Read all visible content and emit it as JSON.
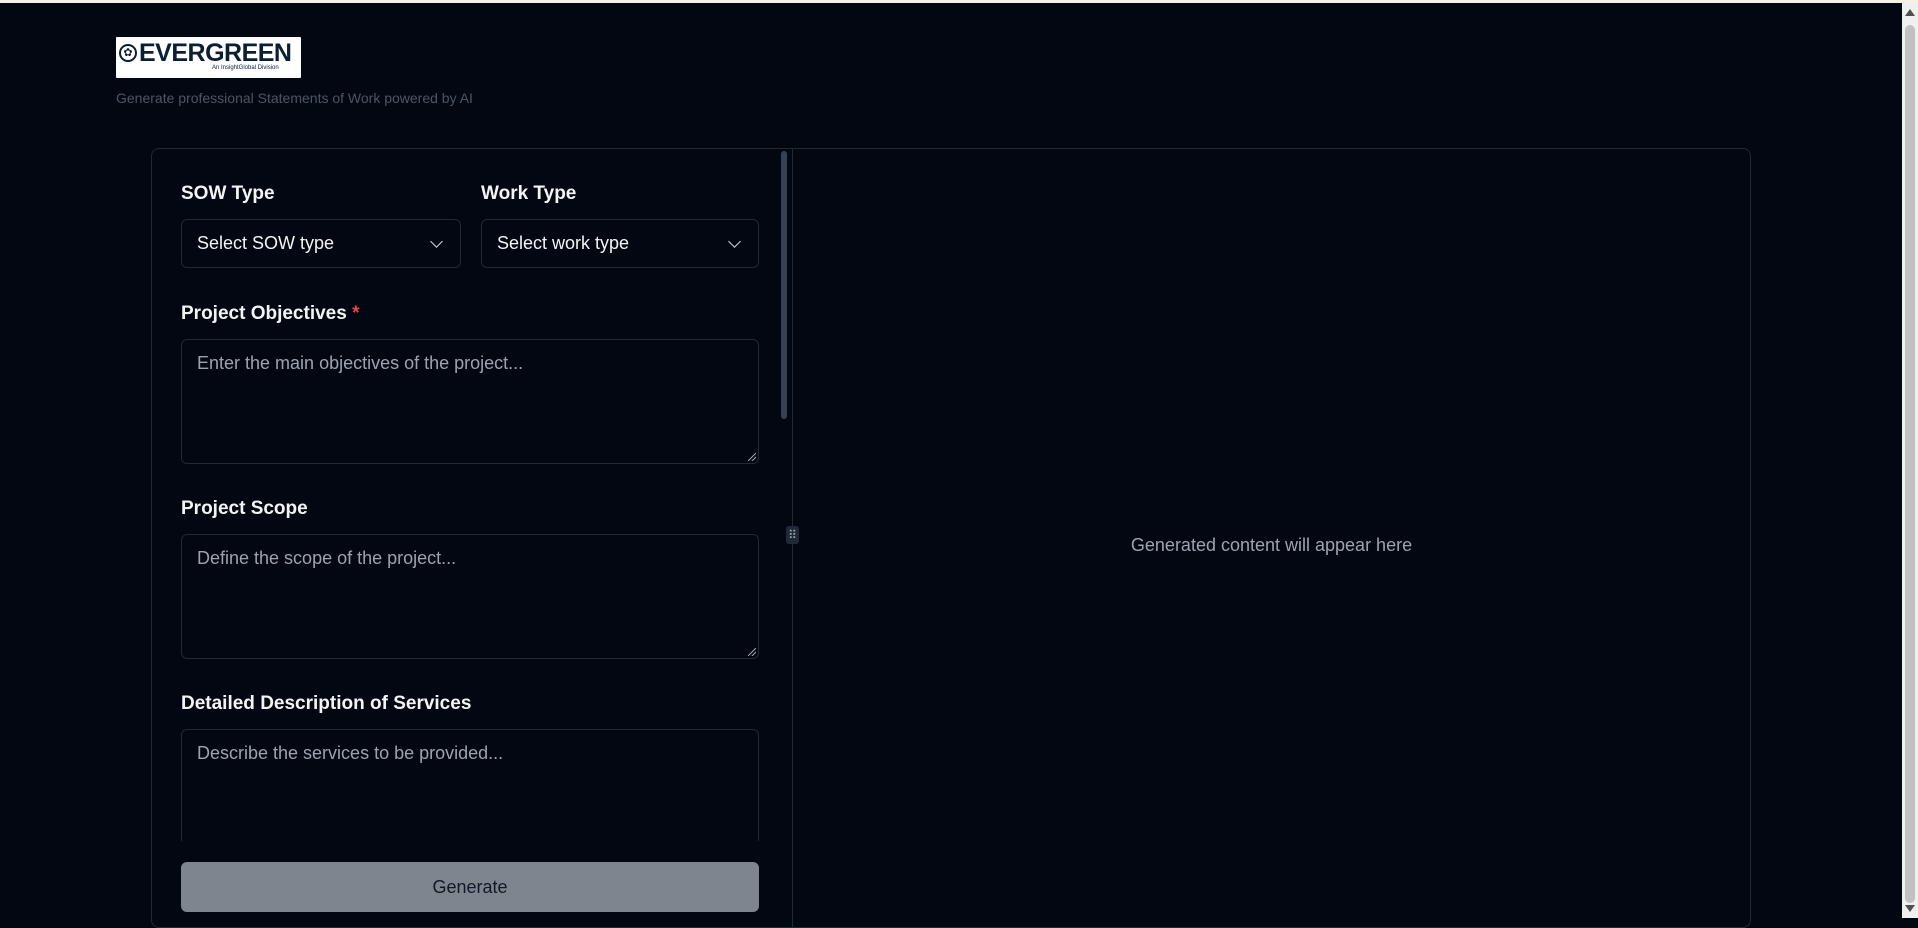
{
  "header": {
    "logo_word": "EVERGREEN",
    "logo_sub": "An InsightGlobal Division",
    "tagline": "Generate professional Statements of Work powered by AI"
  },
  "form": {
    "sow_type": {
      "label": "SOW Type",
      "value": "Select SOW type"
    },
    "work_type": {
      "label": "Work Type",
      "value": "Select work type"
    },
    "objectives": {
      "label": "Project Objectives",
      "required_mark": "*",
      "placeholder": "Enter the main objectives of the project..."
    },
    "scope": {
      "label": "Project Scope",
      "placeholder": "Define the scope of the project..."
    },
    "services": {
      "label": "Detailed Description of Services",
      "placeholder": "Describe the services to be provided..."
    },
    "generate_label": "Generate"
  },
  "output": {
    "placeholder": "Generated content will appear here"
  },
  "icons": {
    "chevron": "chevron-down-icon",
    "grip": "drag-handle-icon",
    "logo": "evergreen-logo-icon"
  },
  "colors": {
    "background": "#030712",
    "border": "#1f2937",
    "required": "#ef4444",
    "button": "#7f858e"
  }
}
